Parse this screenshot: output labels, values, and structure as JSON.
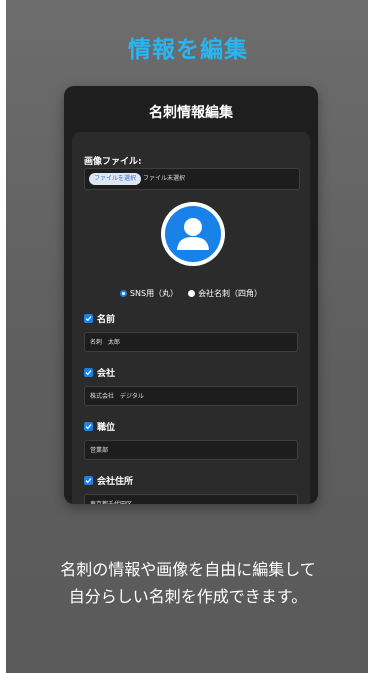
{
  "headline": "情報を編集",
  "screen": {
    "title": "名刺情報編集",
    "image_file_label": "画像ファイル:",
    "file_button_label": "ファイルを選択",
    "file_status": "ファイル未選択",
    "avatar_icon": "person-icon",
    "radio_options": [
      "SNS用（丸）",
      "会社名刺（四角）"
    ],
    "selected_radio": "SNS用（丸）",
    "fields": [
      {
        "label": "名前",
        "value": "名刺　太郎",
        "checked": true
      },
      {
        "label": "会社",
        "value": "株式会社　デジタル",
        "checked": true
      },
      {
        "label": "職位",
        "value": "営業部",
        "checked": true
      },
      {
        "label": "会社住所",
        "value": "東京都千代田区",
        "checked": true
      }
    ]
  },
  "caption_line1": "名刺の情報や画像を自由に編集して",
  "caption_line2": "自分らしい名刺を作成できます。",
  "colors": {
    "accent": "#27b6f2",
    "primary": "#1982e8",
    "background": "#5f5f5f"
  }
}
